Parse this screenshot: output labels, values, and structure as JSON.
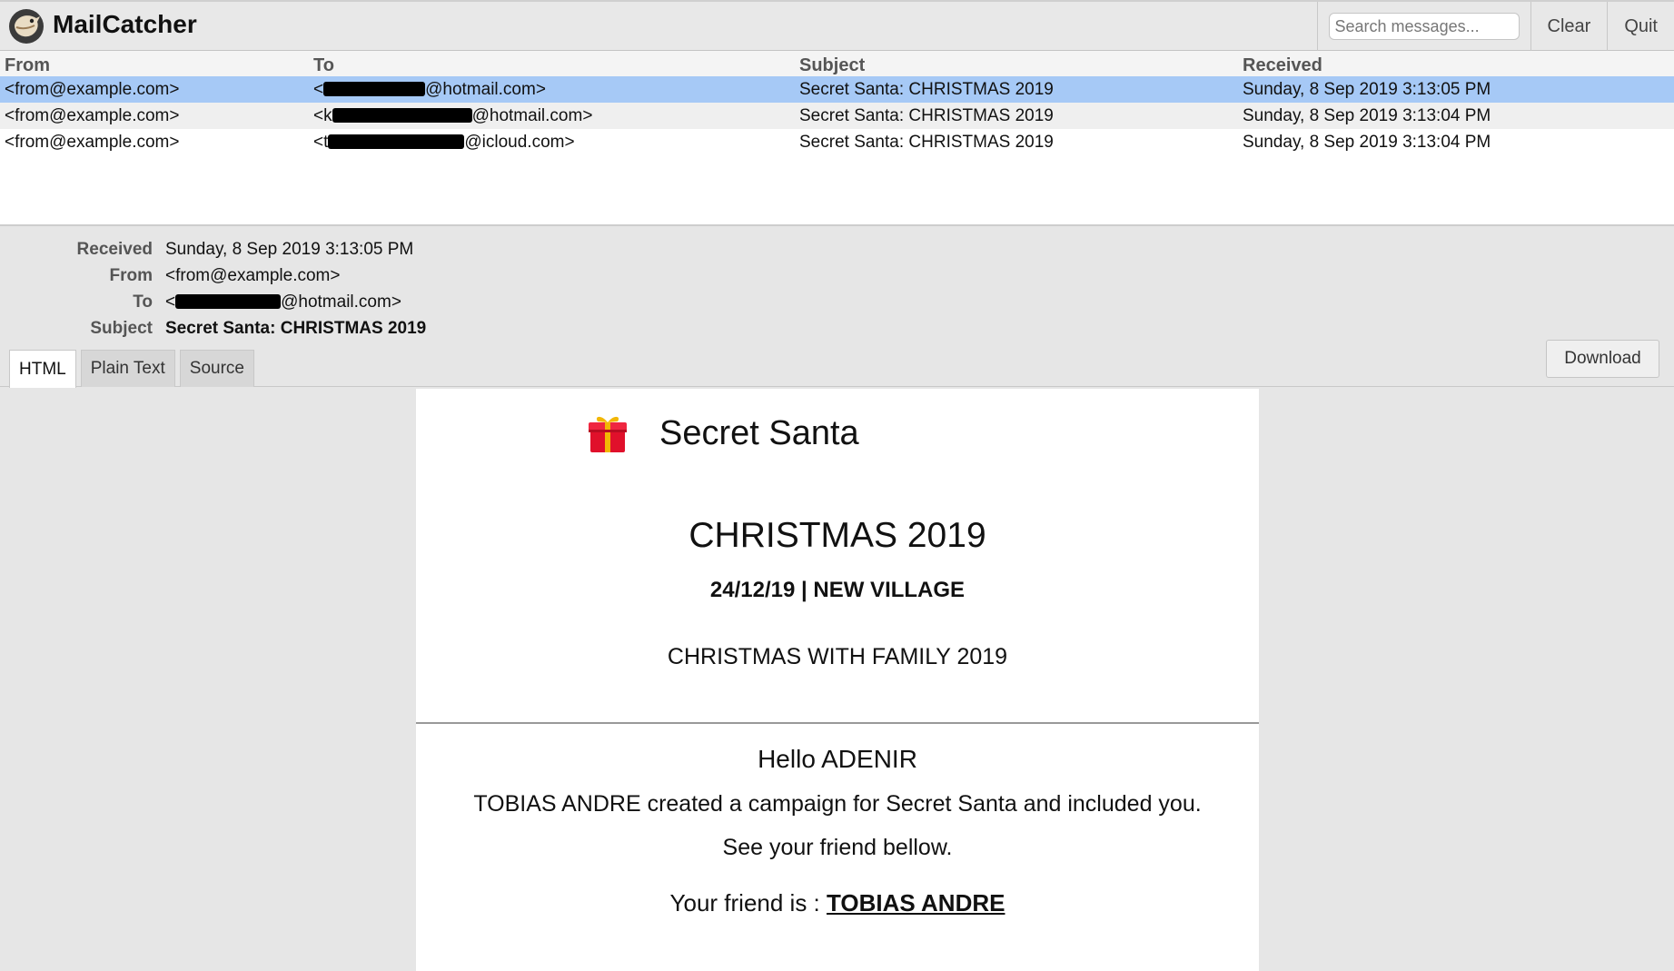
{
  "app": {
    "title": "MailCatcher"
  },
  "header": {
    "search_placeholder": "Search messages...",
    "clear_label": "Clear",
    "quit_label": "Quit"
  },
  "list": {
    "columns": [
      "From",
      "To",
      "Subject",
      "Received"
    ],
    "rows": [
      {
        "from": "<from@example.com>",
        "to_prefix": "<",
        "to_suffix": "@hotmail.com>",
        "subject": "Secret Santa: CHRISTMAS 2019",
        "received": "Sunday, 8 Sep 2019 3:13:05 PM",
        "selected": true
      },
      {
        "from": "<from@example.com>",
        "to_prefix": "<k",
        "to_suffix": "@hotmail.com>",
        "subject": "Secret Santa: CHRISTMAS 2019",
        "received": "Sunday, 8 Sep 2019 3:13:04 PM",
        "selected": false
      },
      {
        "from": "<from@example.com>",
        "to_prefix": "<t",
        "to_suffix": "@icloud.com>",
        "subject": "Secret Santa: CHRISTMAS 2019",
        "received": "Sunday, 8 Sep 2019 3:13:04 PM",
        "selected": false
      }
    ]
  },
  "detail": {
    "labels": {
      "received": "Received",
      "from": "From",
      "to": "To",
      "subject": "Subject"
    },
    "received": "Sunday, 8 Sep 2019 3:13:05 PM",
    "from": "<from@example.com>",
    "to_prefix": "<",
    "to_suffix": "@hotmail.com>",
    "subject": "Secret Santa: CHRISTMAS 2019"
  },
  "tabs": [
    {
      "label": "HTML",
      "active": true
    },
    {
      "label": "Plain Text",
      "active": false
    },
    {
      "label": "Source",
      "active": false
    }
  ],
  "download_label": "Download",
  "email": {
    "brand": "Secret Santa",
    "title": "CHRISTMAS 2019",
    "date_location": "24/12/19 | NEW VILLAGE",
    "event_name": "CHRISTMAS WITH FAMILY 2019",
    "greeting": "Hello ADENIR",
    "line1": "TOBIAS ANDRE created a campaign for Secret Santa and included you.",
    "line2": "See your friend bellow.",
    "friend_prefix": "Your friend is : ",
    "friend_name": "TOBIAS ANDRE"
  },
  "colors": {
    "selected_row": "#a6c9f6",
    "header_bg": "#e8e8e8",
    "gift_red": "#e0102b",
    "gift_gold": "#f2b705"
  },
  "icons": {
    "logo": "mailcatcher-logo-icon",
    "gift": "gift-icon"
  }
}
